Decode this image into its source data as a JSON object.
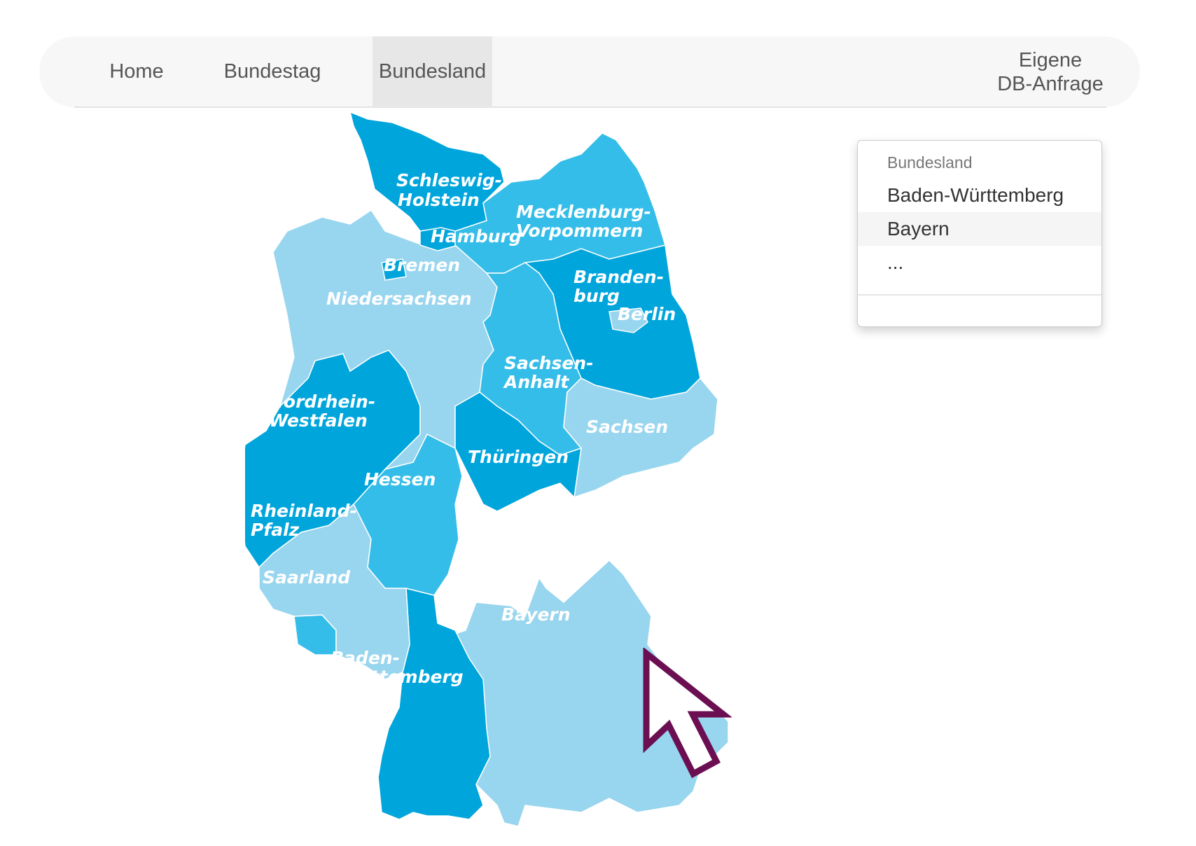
{
  "nav": {
    "home": "Home",
    "bundestag": "Bundestag",
    "bundesland": "Bundesland",
    "db_line1": "Eigene",
    "db_line2": "DB-Anfrage"
  },
  "dropdown": {
    "header": "Bundesland",
    "items": [
      "Baden-Württemberg",
      "Bayern",
      "..."
    ]
  },
  "map": {
    "labels": {
      "sh1": "Schleswig-",
      "sh2": "Holstein",
      "hamburg": "Hamburg",
      "mv1": "Mecklenburg-",
      "mv2": "Vorpommern",
      "bremen": "Bremen",
      "ni": "Niedersachsen",
      "bb1": "Branden-",
      "bb2": "burg",
      "berlin": "Berlin",
      "st1": "Sachsen-",
      "st2": "Anhalt",
      "nrw1": "Nordrhein-",
      "nrw2": "Westfalen",
      "sn": "Sachsen",
      "th": "Thüringen",
      "he": "Hessen",
      "rp1": "Rheinland-",
      "rp2": "Pfalz",
      "sl": "Saarland",
      "by": "Bayern",
      "bw1": "Baden-",
      "bw2": "Württemberg"
    },
    "colors": {
      "dark": "#00a5dc",
      "medium": "#35bde9",
      "light": "#98d5ee"
    }
  },
  "cursor": {
    "color": "#6b0f52"
  }
}
